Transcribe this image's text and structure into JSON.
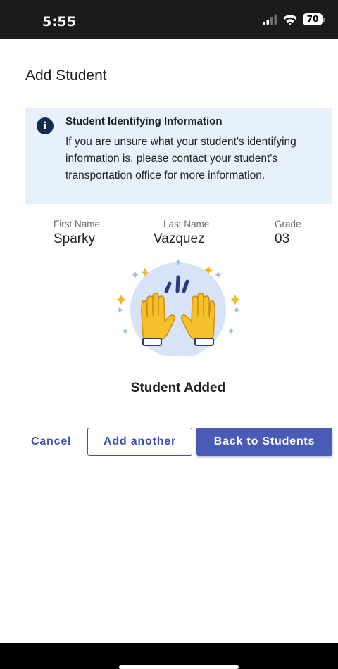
{
  "status_bar": {
    "time": "5:55",
    "battery": "70",
    "icons": [
      "cellular-signal-icon",
      "wifi-icon",
      "battery-icon"
    ]
  },
  "header": {
    "title": "Add Student"
  },
  "info_banner": {
    "icon": "info-icon",
    "icon_glyph": "i",
    "title": "Student Identifying Information",
    "body": "If you are unsure what your student's identifying information is, please contact your student's transportation office for more information."
  },
  "student": {
    "first_name_label": "First Name",
    "first_name": "Sparky",
    "last_name_label": "Last Name",
    "last_name": "Vazquez",
    "grade_label": "Grade",
    "grade": "03"
  },
  "result": {
    "illustration": "raised-hands-icon",
    "message": "Student Added"
  },
  "actions": {
    "cancel_label": "Cancel",
    "add_another_label": "Add another",
    "back_label": "Back to Students"
  },
  "colors": {
    "primary": "#3f51b5",
    "banner_bg": "#e6f1fb",
    "info_icon": "#152b4f",
    "illustration_bg": "#d7e3f6",
    "hand": "#f5c02a",
    "sparkle": "#f3b91d"
  }
}
